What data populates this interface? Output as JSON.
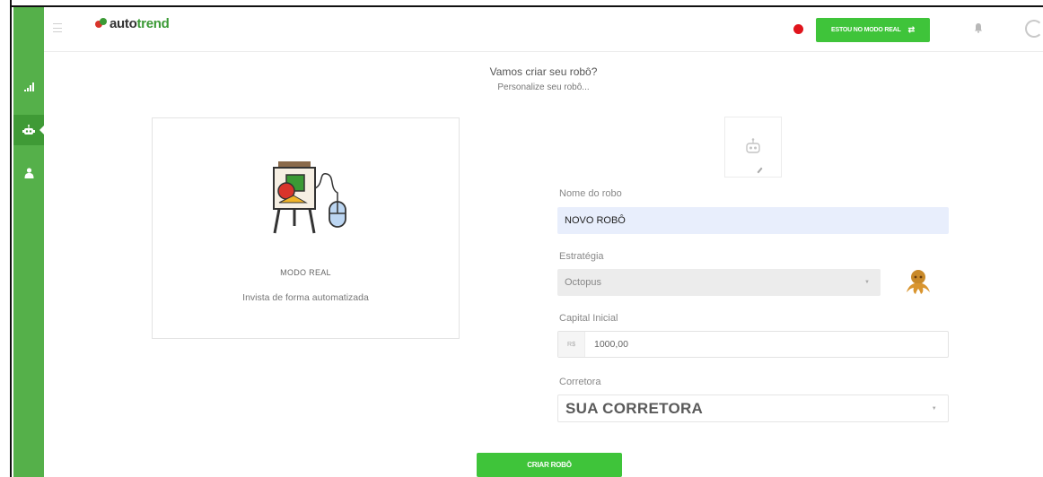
{
  "brand": {
    "logo_part1": "auto",
    "logo_part2": "trend"
  },
  "topbar": {
    "mode_button_label": "ESTOU NO MODO REAL",
    "rec_color": "#e0141c",
    "accent_color": "#3fc43a"
  },
  "sidebar": {
    "items": [
      {
        "icon": "bar-chart-icon",
        "active": false
      },
      {
        "icon": "robot-icon",
        "active": true
      },
      {
        "icon": "user-icon",
        "active": false
      }
    ]
  },
  "header": {
    "title": "Vamos criar seu robô?",
    "subtitle": "Personalize seu robô..."
  },
  "mode_card": {
    "title": "MODO REAL",
    "description": "Invista de forma automatizada"
  },
  "form": {
    "name_label": "Nome do robo",
    "name_value": "NOVO ROBÔ",
    "strategy_label": "Estratégia",
    "strategy_value": "Octopus",
    "capital_label": "Capital Inicial",
    "capital_prefix": "R$",
    "capital_value": "1000,00",
    "broker_label": "Corretora",
    "broker_value": "SUA CORRETORA"
  },
  "actions": {
    "create_label": "CRIAR ROBÔ"
  }
}
